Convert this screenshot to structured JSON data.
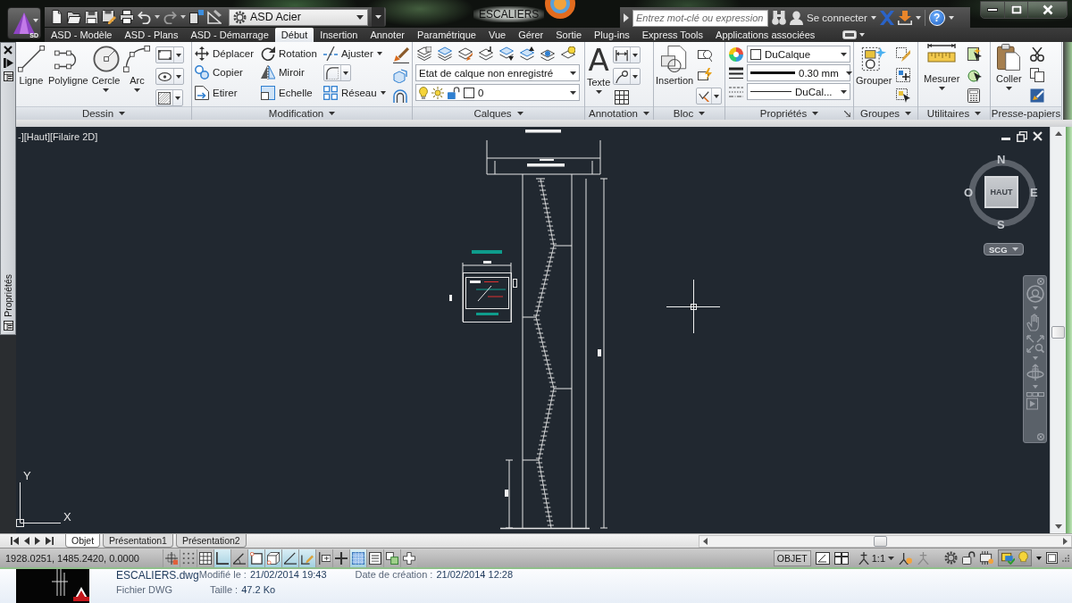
{
  "title_bar": {
    "app_button": "SD",
    "workspace": "ASD Acier",
    "title": "ESCALIERS",
    "search": {
      "placeholder": "Entrez mot-clé ou expression"
    },
    "sign_in": "Se connecter",
    "help": "?"
  },
  "ribbon_tabs": [
    {
      "label": "ASD - Modèle",
      "selected": false
    },
    {
      "label": "ASD - Plans",
      "selected": false
    },
    {
      "label": "ASD - Démarrage",
      "selected": false
    },
    {
      "label": "Début",
      "selected": true
    },
    {
      "label": "Insertion",
      "selected": false
    },
    {
      "label": "Annoter",
      "selected": false
    },
    {
      "label": "Paramétrique",
      "selected": false
    },
    {
      "label": "Vue",
      "selected": false
    },
    {
      "label": "Gérer",
      "selected": false
    },
    {
      "label": "Sortie",
      "selected": false
    },
    {
      "label": "Plug-ins",
      "selected": false
    },
    {
      "label": "Express Tools",
      "selected": false
    },
    {
      "label": "Applications associées",
      "selected": false
    }
  ],
  "ribbon_panels": [
    {
      "kind": "draw",
      "title": "Dessin",
      "title_menu": true,
      "tools": [
        {
          "label": "Ligne",
          "menu": false
        },
        {
          "label": "Polyligne",
          "menu": false
        },
        {
          "label": "Cercle",
          "menu": true
        },
        {
          "label": "Arc",
          "menu": true
        }
      ]
    },
    {
      "kind": "modify",
      "title": "Modification",
      "title_menu": true,
      "rows": [
        [
          {
            "label": "Déplacer",
            "menu": false
          },
          {
            "label": "Rotation",
            "menu": false
          },
          {
            "label": "Ajuster",
            "menu": true
          }
        ],
        [
          {
            "label": "Copier",
            "menu": false
          },
          {
            "label": "Miroir",
            "menu": false
          }
        ],
        [
          {
            "label": "Etirer",
            "menu": false
          },
          {
            "label": "Echelle",
            "menu": false
          },
          {
            "label": "Réseau",
            "menu": true
          }
        ]
      ]
    },
    {
      "kind": "layers",
      "title": "Calques",
      "title_menu": true,
      "layer_state": "Etat de calque non enregistré",
      "current_layer": "0"
    },
    {
      "kind": "annotation",
      "title": "Annotation",
      "title_menu": true,
      "tools": [
        {
          "label": "Texte",
          "glyph": "A",
          "menu": true
        }
      ]
    },
    {
      "kind": "block",
      "title": "Bloc",
      "title_menu": true,
      "tools": [
        {
          "label": "Insertion",
          "menu": false
        }
      ]
    },
    {
      "kind": "properties",
      "title": "Propriétés",
      "title_menu": true,
      "color_setting": "DuCalque",
      "lineweight": "0.30 mm",
      "linetype": "DuCal..."
    },
    {
      "kind": "groups",
      "title": "Groupes",
      "title_menu": true,
      "tools": [
        {
          "label": "Grouper",
          "menu": false
        }
      ]
    },
    {
      "kind": "utilities",
      "title": "Utilitaires",
      "title_menu": true,
      "tools": [
        {
          "label": "Mesurer",
          "menu": true
        }
      ]
    },
    {
      "kind": "clipboard",
      "title": "Presse-papiers",
      "title_menu": false,
      "tools": [
        {
          "label": "Coller",
          "menu": true
        }
      ]
    }
  ],
  "side_palette": {
    "title": "Propriétés"
  },
  "viewport": {
    "label": "-][Haut][Filaire 2D]",
    "view_cube": {
      "north": "N",
      "west": "O",
      "face": "HAUT",
      "east": "E",
      "south": "S"
    },
    "ucs_menu": "SCG",
    "axes": {
      "y": "Y",
      "x": "X"
    }
  },
  "layout_tabs": [
    {
      "label": "Objet",
      "selected": true
    },
    {
      "label": "Présentation1",
      "selected": false
    },
    {
      "label": "Présentation2",
      "selected": false
    }
  ],
  "status_bar": {
    "coordinates": "1928.0251, 1485.2420, 0.0000",
    "toggles": [
      {
        "on": false
      },
      {
        "on": false
      },
      {
        "on": false
      },
      {
        "on": true
      },
      {
        "on": false
      },
      {
        "on": true
      },
      {
        "on": true
      },
      {
        "on": true
      },
      {
        "on": true
      },
      {
        "on": false
      },
      {
        "on": false
      },
      {
        "on": true
      },
      {
        "on": false
      },
      {
        "on": false
      },
      {
        "on": false
      }
    ],
    "space": "OBJET",
    "annotation_scale": "1:1"
  },
  "file_details": {
    "name": "ESCALIERS.dwg",
    "modified_label": "Modifié le :",
    "modified": "21/02/2014 19:43",
    "created_label": "Date de création :",
    "created": "21/02/2014 12:28",
    "type": "Fichier DWG",
    "size_label": "Taille :",
    "size": "47.2 Ko"
  }
}
